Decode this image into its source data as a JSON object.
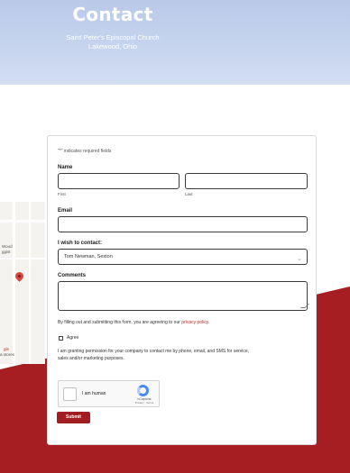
{
  "header": {
    "title": "Contact",
    "subtitle_line1": "Saint Peter's Episcopal Church",
    "subtitle_line2": "Lakewood, Ohio"
  },
  "form": {
    "required_note": "\"*\" indicates required fields",
    "name": {
      "label": "Name",
      "first_value": "",
      "last_value": "",
      "first_label": "First",
      "last_label": "Last"
    },
    "email": {
      "label": "Email",
      "value": ""
    },
    "wish_to_contact": {
      "label": "I wish to contact:",
      "selected": "Tom Newman, Sexton"
    },
    "comments": {
      "label": "Comments",
      "value": ""
    },
    "consent_text_prefix": "By filling out and submitting this form, you are agreeing to our",
    "privacy_link": "privacy policy",
    "consent_text_suffix": ".",
    "agree_label": "Agree",
    "permission_text_line1": "I am granting permission for your company to contact me by phone, email, and SMS for service,",
    "permission_text_line2": "sales and/or marketing purposes.",
    "captcha": {
      "label": "I am human",
      "brand": "hCaptcha",
      "links": "Privacy - Terms"
    },
    "submit_label": "Submit"
  },
  "map": {
    "label1": "Wood",
    "label2": "ggist",
    "label3": "gle",
    "label4": "a stores"
  },
  "colors": {
    "accent": "#a11d22",
    "link": "#c02b2b",
    "hero_bg": "#c6d4ee"
  }
}
